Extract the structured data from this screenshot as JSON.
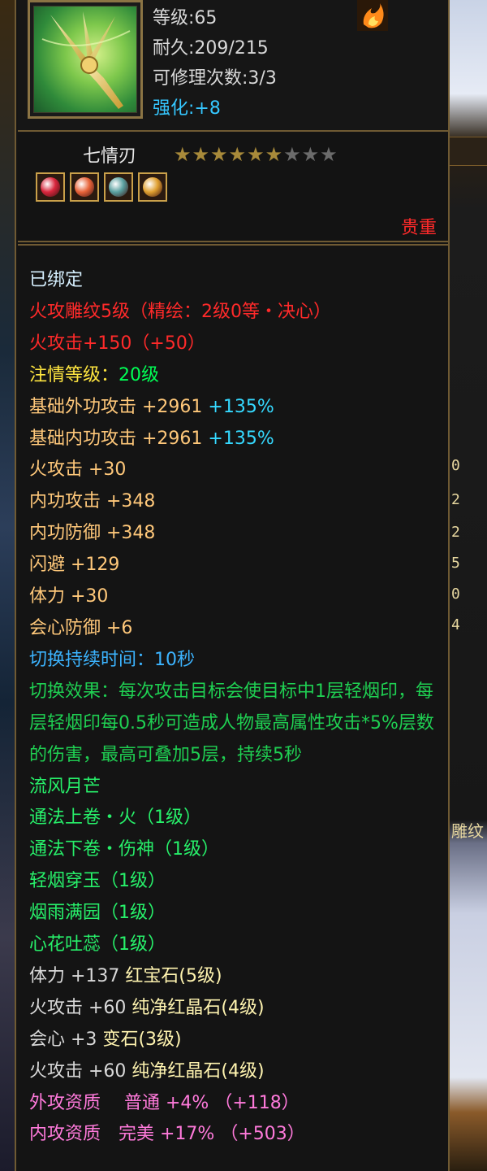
{
  "item": {
    "level": "等级:65",
    "durability": "耐久:209/215",
    "repairs": "可修理次数:3/3",
    "enhance_label": "强化:",
    "enhance_value": "+8",
    "name": "七情刃",
    "stars_filled": 6,
    "stars_total": 9,
    "rarity": "贵重",
    "gems": [
      {
        "icon": "red-gem-icon",
        "color": "#d8263c"
      },
      {
        "icon": "orange-gem-icon",
        "color": "#e8643a"
      },
      {
        "icon": "multicolor-gem-icon",
        "color": "#5aa0a0"
      },
      {
        "icon": "yellow-gem-icon",
        "color": "#e0a030"
      }
    ],
    "icon": "weapon-sword-icon"
  },
  "attributes": {
    "bound": "已绑定",
    "engrave": "火攻雕纹5级（精绘：2级0等・决心）",
    "fire_attack": "火攻击+150（+50）",
    "devotion_label": "注情等级：",
    "devotion_value": "20级",
    "base_ext_label": "基础外功攻击 +2961",
    "base_ext_pct": "+135%",
    "base_int_label": "基础内功攻击 +2961",
    "base_int_pct": "+135%",
    "gold_stats": [
      "火攻击 +30",
      "内功攻击 +348",
      "内功防御 +348",
      "闪避 +129",
      "体力 +30",
      "会心防御 +6"
    ],
    "switch_duration": "切换持续时间：10秒",
    "switch_effect": "切换效果：每次攻击目标会使目标中1层轻烟印，每层轻烟印每0.5秒可造成人物最高属性攻击*5%层数的伤害，最高可叠加5层，持续5秒",
    "skill_set": [
      "流风月芒",
      "通法上卷・火（1级）",
      "通法下卷・伤神（1级）",
      "轻烟穿玉（1级）",
      "烟雨满园（1级）",
      "心花吐蕊（1级）"
    ],
    "gem_lines": [
      {
        "stat": "体力 +137",
        "gem": "红宝石(5级)"
      },
      {
        "stat": "火攻击 +60",
        "gem": "纯净红晶石(4级)"
      },
      {
        "stat": "会心 +3",
        "gem": "变石(3级)"
      },
      {
        "stat": "火攻击 +60",
        "gem": "纯净红晶石(4级)"
      }
    ],
    "aptitude": [
      "外攻资质　 普通 +4% （+118）",
      "内攻资质　完美 +17% （+503）"
    ]
  },
  "side_numbers": [
    "0",
    "2",
    "2",
    "5",
    "0",
    "4"
  ],
  "side_text": "雕纹",
  "colors": {
    "frame": "#6f5a33",
    "rarity": "#ff2a2a",
    "enhance": "#35c7ff"
  }
}
